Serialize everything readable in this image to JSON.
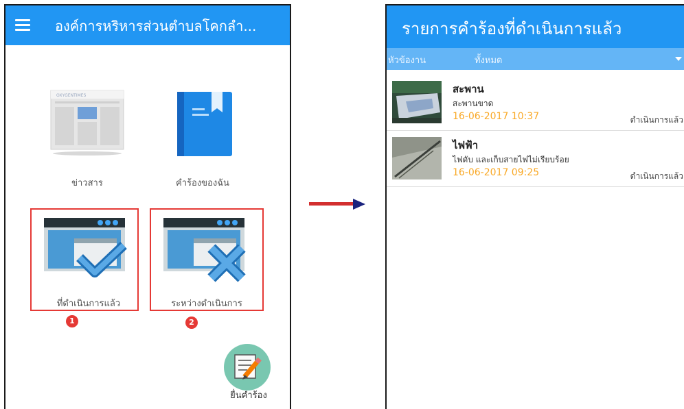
{
  "left": {
    "appbar_title": "องค์การหริหารส่วนตำบลโคกลำ...",
    "tiles": [
      {
        "label": "ข่าวสาร",
        "icon": "newspaper-icon"
      },
      {
        "label": "คำร้องของฉัน",
        "icon": "book-icon"
      },
      {
        "label": "ที่ดำเนินการแล้ว",
        "icon": "window-check-icon"
      },
      {
        "label": "ระหว่างดำเนินการ",
        "icon": "window-cross-icon"
      }
    ],
    "newspaper_masthead": "OXYGENTIMES",
    "badges": [
      "1",
      "2"
    ],
    "fab_label": "ยื่นคำร้อง"
  },
  "right": {
    "appbar_title": "รายการคำร้องที่ดำเนินการแล้ว",
    "filter": {
      "label": "หัวข้องาน",
      "value": "ทั้งหมด"
    },
    "items": [
      {
        "title": "สะพาน",
        "desc": "สะพานขาด",
        "date": "16-06-2017 10:37",
        "status": "ดำเนินการแล้ว"
      },
      {
        "title": "ไฟฟ้า",
        "desc": "ไฟดับ และเก็บสายไฟไม่เรียบร้อย",
        "date": "16-06-2017 09:25",
        "status": "ดำเนินการแล้ว"
      }
    ]
  },
  "colors": {
    "primary": "#2196f3",
    "highlight": "#e53935",
    "date": "#f9a825",
    "fab": "#79c7b0"
  }
}
